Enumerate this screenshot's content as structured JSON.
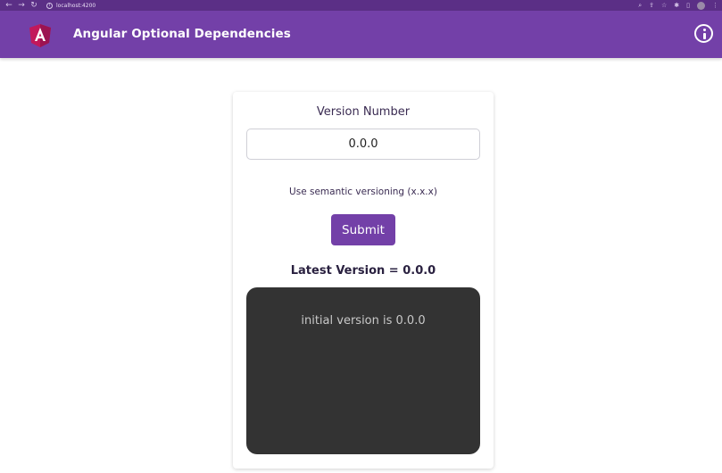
{
  "browser": {
    "url": "localhost:4200",
    "back_icon": "arrow-left-icon",
    "forward_icon": "arrow-right-icon",
    "reload_icon": "reload-icon"
  },
  "toolbar": {
    "title": "Angular Optional Dependencies",
    "info_icon": "info-icon",
    "color": "#7340a8"
  },
  "form": {
    "label": "Version Number",
    "input_value": "0.0.0",
    "hint": "Use semantic versioning (x.x.x)",
    "submit_label": "Submit"
  },
  "result": {
    "latest_text": "Latest Version = 0.0.0",
    "log_text": "initial version is 0.0.0"
  },
  "colors": {
    "accent": "#7340a8",
    "panel": "#333333"
  }
}
